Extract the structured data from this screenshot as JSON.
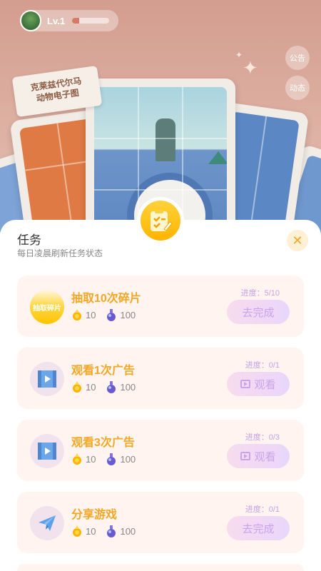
{
  "header": {
    "level_label": "Lv.1",
    "level_progress": 0.2,
    "notice_label": "公告",
    "moments_label": "动态"
  },
  "background": {
    "sign_text": "克莱兹代尔马\n动物电子图"
  },
  "panel": {
    "title": "任务",
    "subtitle": "每日凌晨刷新任务状态",
    "close_icon": "close-icon"
  },
  "tasks": [
    {
      "name": "抽取10次碎片",
      "icon": "shard-draw-icon",
      "icon_text": "抽取碎片",
      "reward_coin": "10",
      "reward_potion": "100",
      "progress": "进度：5/10",
      "action": "去完成"
    },
    {
      "name": "观看1次广告",
      "icon": "video-icon",
      "reward_coin": "10",
      "reward_potion": "100",
      "progress": "进度：0/1",
      "action": "观看"
    },
    {
      "name": "观看3次广告",
      "icon": "video-icon",
      "reward_coin": "10",
      "reward_potion": "100",
      "progress": "进度：0/3",
      "action": "观看"
    },
    {
      "name": "分享游戏",
      "icon": "paper-plane-icon",
      "reward_coin": "10",
      "reward_potion": "100",
      "progress": "进度：0/1",
      "action": "去完成"
    }
  ],
  "colors": {
    "accent": "#f5a623",
    "button_text": "#cba2ec",
    "task_bg": "#fff4ef"
  }
}
